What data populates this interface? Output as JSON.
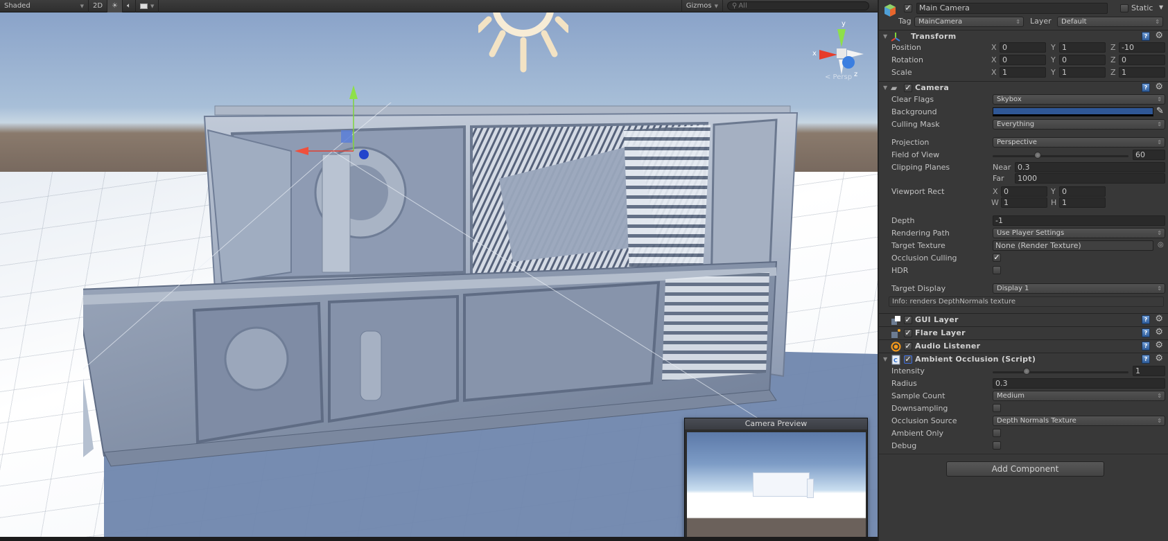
{
  "scene_toolbar": {
    "draw_mode": "Shaded",
    "mode_2d": "2D",
    "lighting_icon": "sun-icon",
    "audio_icon": "speaker-icon",
    "effects_icon": "image-icon",
    "gizmos_label": "Gizmos",
    "search_placeholder": "All"
  },
  "scene_view": {
    "projection_label": "< Persp",
    "gizmo_axes": [
      "y",
      "x",
      "z"
    ],
    "camera_preview_title": "Camera Preview"
  },
  "inspector": {
    "object_name": "Main Camera",
    "active": true,
    "static_label": "Static",
    "static": false,
    "tag_label": "Tag",
    "tag_value": "MainCamera",
    "layer_label": "Layer",
    "layer_value": "Default",
    "transform": {
      "title": "Transform",
      "position": {
        "label": "Position",
        "x": "0",
        "y": "1",
        "z": "-10"
      },
      "rotation": {
        "label": "Rotation",
        "x": "0",
        "y": "0",
        "z": "0"
      },
      "scale": {
        "label": "Scale",
        "x": "1",
        "y": "1",
        "z": "1"
      }
    },
    "camera": {
      "title": "Camera",
      "enabled": true,
      "clear_flags": {
        "label": "Clear Flags",
        "value": "Skybox"
      },
      "background": {
        "label": "Background",
        "color": "#2f5796"
      },
      "culling_mask": {
        "label": "Culling Mask",
        "value": "Everything"
      },
      "projection": {
        "label": "Projection",
        "value": "Perspective"
      },
      "field_of_view": {
        "label": "Field of View",
        "value": "60",
        "min": 1,
        "max": 179
      },
      "clipping_planes": {
        "label": "Clipping Planes",
        "near_label": "Near",
        "near": "0.3",
        "far_label": "Far",
        "far": "1000"
      },
      "viewport_rect": {
        "label": "Viewport Rect",
        "x": "0",
        "y": "0",
        "w": "1",
        "h": "1"
      },
      "depth": {
        "label": "Depth",
        "value": "-1"
      },
      "rendering_path": {
        "label": "Rendering Path",
        "value": "Use Player Settings"
      },
      "target_texture": {
        "label": "Target Texture",
        "value": "None (Render Texture)"
      },
      "occlusion_culling": {
        "label": "Occlusion Culling",
        "checked": true
      },
      "hdr": {
        "label": "HDR",
        "checked": false
      },
      "target_display": {
        "label": "Target Display",
        "value": "Display 1"
      },
      "info": "Info: renders DepthNormals texture"
    },
    "gui_layer": {
      "title": "GUI Layer",
      "enabled": true
    },
    "flare_layer": {
      "title": "Flare Layer",
      "enabled": true
    },
    "audio_listener": {
      "title": "Audio Listener",
      "enabled": true
    },
    "ambient_occlusion": {
      "title": "Ambient Occlusion (Script)",
      "enabled": true,
      "intensity": {
        "label": "Intensity",
        "value": "1",
        "min": 0,
        "max": 4
      },
      "radius": {
        "label": "Radius",
        "value": "0.3"
      },
      "sample_count": {
        "label": "Sample Count",
        "value": "Medium"
      },
      "downsampling": {
        "label": "Downsampling",
        "checked": false
      },
      "occlusion_source": {
        "label": "Occlusion Source",
        "value": "Depth Normals Texture"
      },
      "ambient_only": {
        "label": "Ambient Only",
        "checked": false
      },
      "debug": {
        "label": "Debug",
        "checked": false
      }
    },
    "add_component_label": "Add Component"
  }
}
